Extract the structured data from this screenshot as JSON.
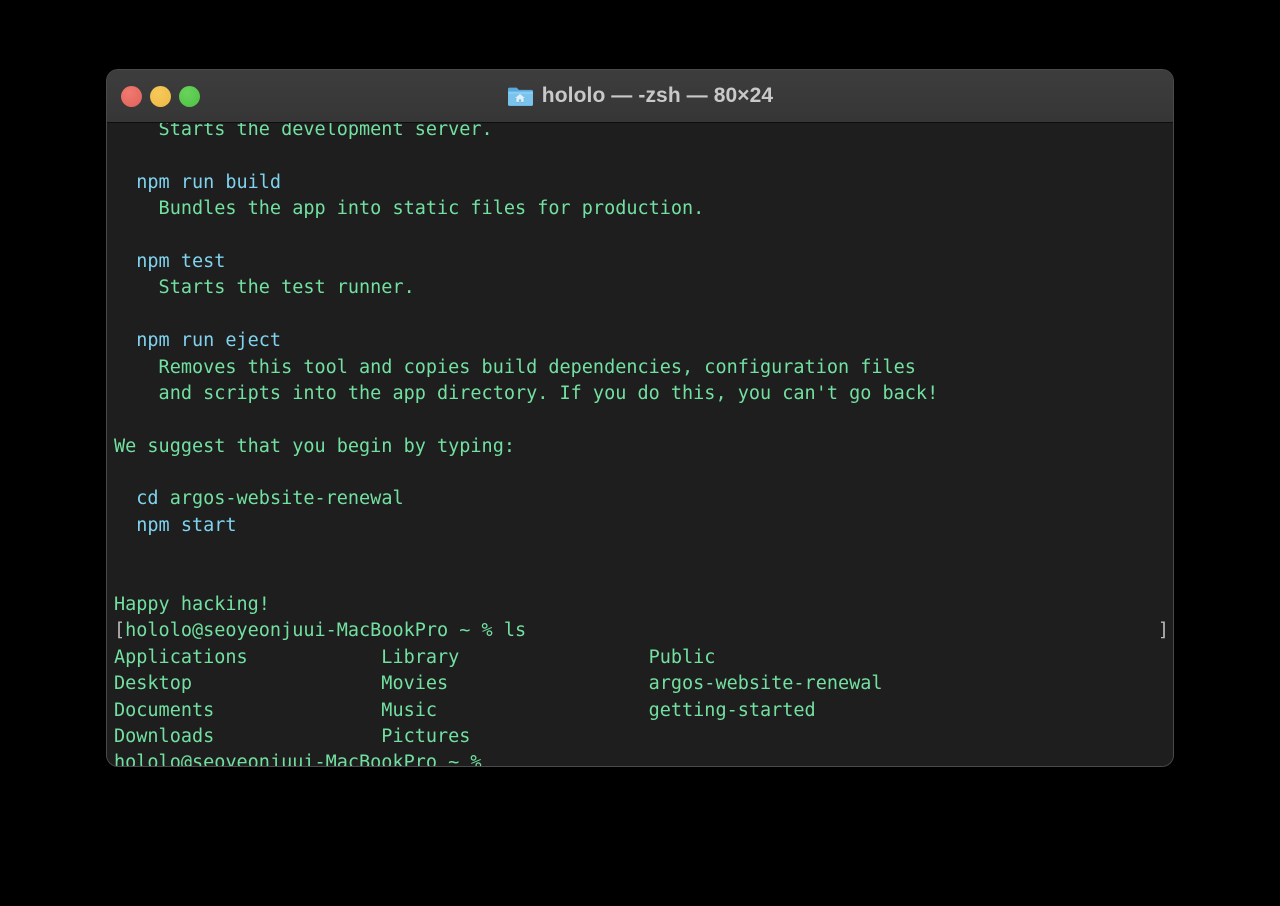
{
  "window": {
    "title": "hololo — -zsh — 80×24",
    "icon": "home-folder-icon",
    "traffic_lights": {
      "close_label": "close",
      "minimize_label": "minimize",
      "zoom_label": "zoom",
      "close_color": "#e0615a",
      "minimize_color": "#eeb840",
      "zoom_color": "#4cc043"
    },
    "titlebar_color": "#3a3a3a",
    "body_color": "#1e1e1e"
  },
  "theme": {
    "green": "#72e0a0",
    "cyan": "#7fd3ef",
    "marker": "#b9b9b9",
    "background": "#1e1e1e",
    "desktop": "#000000"
  },
  "terminal": {
    "cols": 80,
    "rows": 24,
    "shell": "-zsh",
    "lines": [
      {
        "id": "l01",
        "segments": [
          {
            "text": "    Starts the development server.",
            "color": "green"
          }
        ]
      },
      {
        "id": "l02",
        "segments": [
          {
            "text": "",
            "color": "green"
          }
        ]
      },
      {
        "id": "l03",
        "segments": [
          {
            "text": "  npm run build",
            "color": "cyan"
          }
        ]
      },
      {
        "id": "l04",
        "segments": [
          {
            "text": "    Bundles the app into static files for production.",
            "color": "green"
          }
        ]
      },
      {
        "id": "l05",
        "segments": [
          {
            "text": "",
            "color": "green"
          }
        ]
      },
      {
        "id": "l06",
        "segments": [
          {
            "text": "  npm test",
            "color": "cyan"
          }
        ]
      },
      {
        "id": "l07",
        "segments": [
          {
            "text": "    Starts the test runner.",
            "color": "green"
          }
        ]
      },
      {
        "id": "l08",
        "segments": [
          {
            "text": "",
            "color": "green"
          }
        ]
      },
      {
        "id": "l09",
        "segments": [
          {
            "text": "  npm run eject",
            "color": "cyan"
          }
        ]
      },
      {
        "id": "l10",
        "segments": [
          {
            "text": "    Removes this tool and copies build dependencies, configuration files",
            "color": "green"
          }
        ]
      },
      {
        "id": "l11",
        "segments": [
          {
            "text": "    and scripts into the app directory. If you do this, you can't go back!",
            "color": "green"
          }
        ]
      },
      {
        "id": "l12",
        "segments": [
          {
            "text": "",
            "color": "green"
          }
        ]
      },
      {
        "id": "l13",
        "segments": [
          {
            "text": "We suggest that you begin by typing:",
            "color": "green"
          }
        ]
      },
      {
        "id": "l14",
        "segments": [
          {
            "text": "",
            "color": "green"
          }
        ]
      },
      {
        "id": "l15",
        "segments": [
          {
            "text": "  cd ",
            "color": "cyan"
          },
          {
            "text": "argos-website-renewal",
            "color": "green"
          }
        ]
      },
      {
        "id": "l16",
        "segments": [
          {
            "text": "  npm start",
            "color": "cyan"
          }
        ]
      },
      {
        "id": "l17",
        "segments": [
          {
            "text": "",
            "color": "green"
          }
        ]
      },
      {
        "id": "l18",
        "segments": [
          {
            "text": "",
            "color": "green"
          }
        ]
      },
      {
        "id": "l19",
        "segments": [
          {
            "text": "Happy hacking!",
            "color": "green"
          }
        ]
      },
      {
        "id": "l20",
        "marker_left": "[",
        "marker_right": "]",
        "segments": [
          {
            "text": "hololo@seoyeonjuui-MacBookPro ~ % ls",
            "color": "green"
          }
        ]
      },
      {
        "id": "l21",
        "segments": [
          {
            "text": "Applications            Library                 Public",
            "color": "green"
          }
        ]
      },
      {
        "id": "l22",
        "segments": [
          {
            "text": "Desktop                 Movies                  argos-website-renewal",
            "color": "green"
          }
        ]
      },
      {
        "id": "l23",
        "segments": [
          {
            "text": "Documents               Music                   getting-started",
            "color": "green"
          }
        ]
      },
      {
        "id": "l24",
        "segments": [
          {
            "text": "Downloads               Pictures",
            "color": "green"
          }
        ]
      },
      {
        "id": "l25",
        "segments": [
          {
            "text": "hololo@seoyeonjuui-MacBookPro ~ % ",
            "color": "green"
          }
        ]
      }
    ],
    "prompt": {
      "user": "hololo",
      "host": "seoyeonjuui-MacBookPro",
      "cwd": "~",
      "symbol": "%",
      "last_command": "ls"
    },
    "ls_output": {
      "columns": [
        [
          "Applications",
          "Desktop",
          "Documents",
          "Downloads"
        ],
        [
          "Library",
          "Movies",
          "Music",
          "Pictures"
        ],
        [
          "Public",
          "argos-website-renewal",
          "getting-started"
        ]
      ]
    }
  }
}
